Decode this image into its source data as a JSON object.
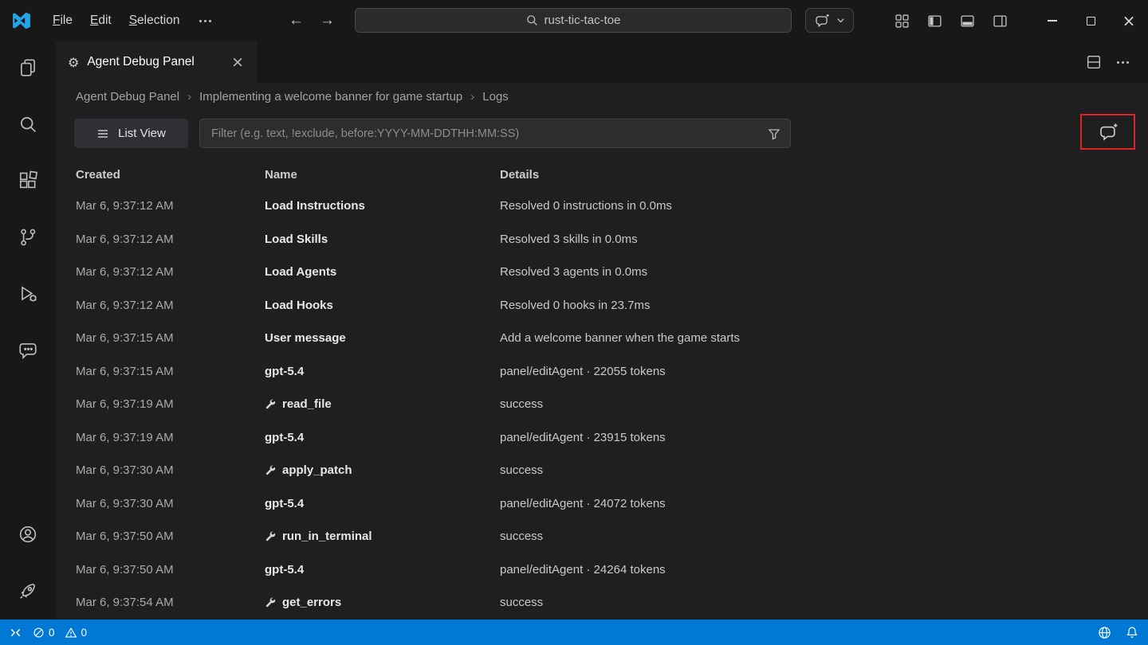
{
  "colors": {
    "statusbar_bg": "#0078d4",
    "annotation_red": "#e02424",
    "logo_blue": "#24a4e8",
    "titlebar_bg": "#181818",
    "editor_bg": "#1f1f1f"
  },
  "titlebar": {
    "menus": [
      "File",
      "Edit",
      "Selection"
    ],
    "search_value": "rust-tic-tac-toe"
  },
  "editor": {
    "tab_title": "Agent Debug Panel",
    "breadcrumbs": [
      "Agent Debug Panel",
      "Implementing a welcome banner for game startup",
      "Logs"
    ],
    "toolbar": {
      "list_view_label": "List View",
      "filter_placeholder": "Filter (e.g. text, !exclude, before:YYYY-MM-DDTHH:MM:SS)"
    },
    "table": {
      "columns": [
        "Created",
        "Name",
        "Details"
      ],
      "rows": [
        {
          "created": "Mar 6, 9:37:12 AM",
          "name": "Load Instructions",
          "tool": false,
          "details": "Resolved 0 instructions in 0.0ms"
        },
        {
          "created": "Mar 6, 9:37:12 AM",
          "name": "Load Skills",
          "tool": false,
          "details": "Resolved 3 skills in 0.0ms"
        },
        {
          "created": "Mar 6, 9:37:12 AM",
          "name": "Load Agents",
          "tool": false,
          "details": "Resolved 3 agents in 0.0ms"
        },
        {
          "created": "Mar 6, 9:37:12 AM",
          "name": "Load Hooks",
          "tool": false,
          "details": "Resolved 0 hooks in 23.7ms"
        },
        {
          "created": "Mar 6, 9:37:15 AM",
          "name": "User message",
          "tool": false,
          "details": "Add a welcome banner when the game starts"
        },
        {
          "created": "Mar 6, 9:37:15 AM",
          "name": "gpt-5.4",
          "tool": false,
          "details": "panel/editAgent · 22055 tokens"
        },
        {
          "created": "Mar 6, 9:37:19 AM",
          "name": "read_file",
          "tool": true,
          "details": "success"
        },
        {
          "created": "Mar 6, 9:37:19 AM",
          "name": "gpt-5.4",
          "tool": false,
          "details": "panel/editAgent · 23915 tokens"
        },
        {
          "created": "Mar 6, 9:37:30 AM",
          "name": "apply_patch",
          "tool": true,
          "details": "success"
        },
        {
          "created": "Mar 6, 9:37:30 AM",
          "name": "gpt-5.4",
          "tool": false,
          "details": "panel/editAgent · 24072 tokens"
        },
        {
          "created": "Mar 6, 9:37:50 AM",
          "name": "run_in_terminal",
          "tool": true,
          "details": "success"
        },
        {
          "created": "Mar 6, 9:37:50 AM",
          "name": "gpt-5.4",
          "tool": false,
          "details": "panel/editAgent · 24264 tokens"
        },
        {
          "created": "Mar 6, 9:37:54 AM",
          "name": "get_errors",
          "tool": true,
          "details": "success"
        }
      ]
    }
  },
  "statusbar": {
    "errors": "0",
    "warnings": "0"
  }
}
